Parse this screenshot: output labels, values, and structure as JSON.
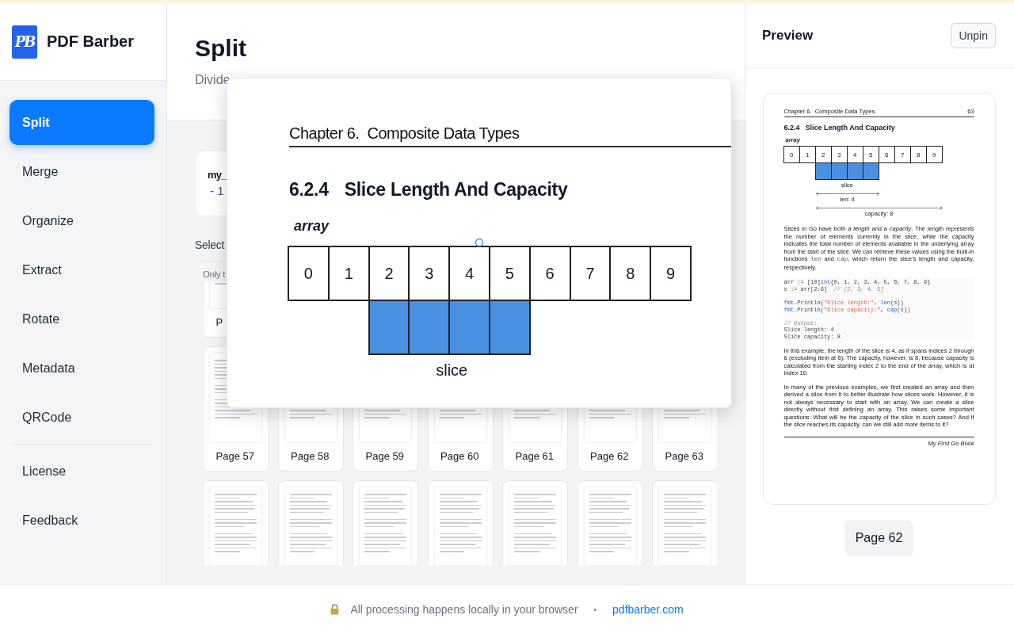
{
  "sidebar": {
    "logo_mark": "PB",
    "brand": "PDF Barber",
    "items": [
      {
        "label": "Split",
        "selected": true
      },
      {
        "label": "Merge",
        "selected": false
      },
      {
        "label": "Organize",
        "selected": false
      },
      {
        "label": "Extract",
        "selected": false
      },
      {
        "label": "Rotate",
        "selected": false
      },
      {
        "label": "Metadata",
        "selected": false
      },
      {
        "label": "QRCode",
        "selected": false
      }
    ],
    "secondary_items": [
      {
        "label": "License",
        "selected": false
      },
      {
        "label": "Feedback",
        "selected": false
      }
    ]
  },
  "main": {
    "title": "Split",
    "subtitle": "Divide",
    "file": {
      "name": "my_",
      "info": "- 1"
    },
    "select_label": "Select",
    "hint": "Only t",
    "thumbnail_rows": [
      {
        "labels": [
          "P"
        ]
      },
      {
        "labels": [
          "Page 57",
          "Page 58",
          "Page 59",
          "Page 60",
          "Page 61",
          "Page 62",
          "Page 63"
        ]
      }
    ],
    "more_rows_below": true
  },
  "zoom_popup": {
    "header": "Chapter 6.  Composite Data Types",
    "section_number": "6.2.4",
    "section_title": "Slice Length And Capacity",
    "array_label": "array",
    "cells": [
      {
        "label": "0",
        "in_slice": false
      },
      {
        "label": "1",
        "in_slice": false
      },
      {
        "label": "2",
        "in_slice": true
      },
      {
        "label": "3",
        "in_slice": true
      },
      {
        "label": "4",
        "in_slice": true
      },
      {
        "label": "5",
        "in_slice": true
      },
      {
        "label": "6",
        "in_slice": false
      },
      {
        "label": "7",
        "in_slice": false
      },
      {
        "label": "8",
        "in_slice": false
      },
      {
        "label": "9",
        "in_slice": false
      }
    ],
    "slice_label": "slice"
  },
  "preview": {
    "title": "Preview",
    "unpin_button": "Unpin",
    "page_badge": "Page 62",
    "doc": {
      "header": "Chapter 6.  Composite Data Types",
      "page_number": "63",
      "section_number": "6.2.4",
      "section_title": "Slice Length And Capacity",
      "array_label": "array",
      "cells": [
        {
          "label": "0",
          "in_slice": false
        },
        {
          "label": "1",
          "in_slice": false
        },
        {
          "label": "2",
          "in_slice": true
        },
        {
          "label": "3",
          "in_slice": true
        },
        {
          "label": "4",
          "in_slice": true
        },
        {
          "label": "5",
          "in_slice": true
        },
        {
          "label": "6",
          "in_slice": false
        },
        {
          "label": "7",
          "in_slice": false
        },
        {
          "label": "8",
          "in_slice": false
        },
        {
          "label": "9",
          "in_slice": false
        }
      ],
      "slice_label": "slice",
      "len_label": "len: 4",
      "capacity_label": "capacity: 8",
      "paragraph_1": [
        {
          "kind": "text",
          "text": "Slices in Go have both a *length* and a *capacity*. The length represents the number of elements currently in the slice, while the capacity indicates the total number of elements available in the underlying array from the start of the slice. We can retrieve these values using the built-in functions "
        },
        {
          "kind": "code",
          "text": "len"
        },
        {
          "kind": "text",
          "text": " and "
        },
        {
          "kind": "code",
          "text": "cap"
        },
        {
          "kind": "text",
          "text": ", which return the slice's length and capacity, respectively."
        }
      ],
      "code_lines": [
        {
          "kind": "line",
          "tokens": [
            {
              "kind": "plain",
              "text": "arr := [10]"
            },
            {
              "kind": "keyword",
              "text": "int"
            },
            {
              "kind": "plain",
              "text": "{0, 1, 2, 3, 4, 5, 6, 7, 8, 9}"
            }
          ]
        },
        {
          "kind": "line",
          "tokens": [
            {
              "kind": "plain",
              "text": "s := arr[2:6]  "
            },
            {
              "kind": "comment",
              "text": "// [2, 3, 4, 5]"
            }
          ]
        },
        {
          "kind": "blank"
        },
        {
          "kind": "line",
          "tokens": [
            {
              "kind": "keyword",
              "text": "fmt"
            },
            {
              "kind": "plain",
              "text": ".Println("
            },
            {
              "kind": "string",
              "text": "\"Slice length:\""
            },
            {
              "kind": "plain",
              "text": ", "
            },
            {
              "kind": "keyword",
              "text": "len"
            },
            {
              "kind": "plain",
              "text": "(s))"
            }
          ]
        },
        {
          "kind": "line",
          "tokens": [
            {
              "kind": "keyword",
              "text": "fmt"
            },
            {
              "kind": "plain",
              "text": ".Println("
            },
            {
              "kind": "string",
              "text": "\"Slice capacity:\""
            },
            {
              "kind": "plain",
              "text": ", "
            },
            {
              "kind": "keyword",
              "text": "cap"
            },
            {
              "kind": "plain",
              "text": "(s))"
            }
          ]
        },
        {
          "kind": "blank"
        },
        {
          "kind": "line",
          "tokens": [
            {
              "kind": "comment",
              "text": "// Output:"
            }
          ]
        },
        {
          "kind": "line",
          "tokens": [
            {
              "kind": "plain",
              "text": "Slice length: 4"
            }
          ]
        },
        {
          "kind": "line",
          "tokens": [
            {
              "kind": "plain",
              "text": "Slice capacity: 8"
            }
          ]
        }
      ],
      "paragraph_2": "In this example, the length of the slice is 4, as it spans indices 2 through 6 (excluding item at 6).  The capacity, however, is 8, because capacity is calculated from the starting index 2 to the end of the array, which is at index 10.",
      "paragraph_3": "In many of the previous examples, we first created an array and then derived a slice from it to better illustrate how slices work. However, it is not always necessary to start with an array. We can create a slice directly without first defining an array. This raises some important questions: What will be the capacity of the slice in such cases? And if the slice reaches its capacity, can we still add more items to it?",
      "footer": "My First Go Book"
    }
  },
  "footer": {
    "notice": "All processing happens locally in your browser",
    "separator": "•",
    "link": "pdfbarber.com"
  }
}
